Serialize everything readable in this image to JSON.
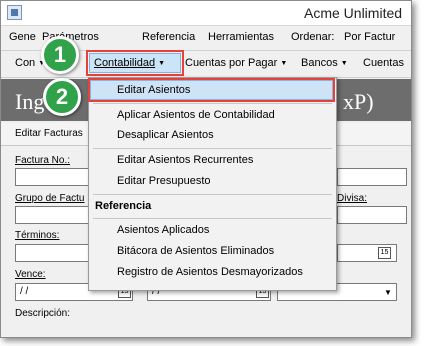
{
  "window": {
    "title": "Acme Unlimited"
  },
  "menubar": {
    "items": [
      "Gene",
      "Parámetros",
      "Referencia",
      "Herramientas",
      "Ordenar:",
      "Por Factur"
    ]
  },
  "toolbar": {
    "items": [
      "Con",
      "Contabilidad",
      "Cuentas por Pagar",
      "Bancos",
      "Cuentas"
    ]
  },
  "header": {
    "title": "Ing",
    "suffix": "xP)"
  },
  "subtab": {
    "label": "Editar Facturas"
  },
  "form": {
    "factura_label": "Factura No.:",
    "grupo_label": "Grupo de Factu",
    "divisa_label": "Divisa:",
    "terminos_label": "Términos:",
    "vence_label": "Vence:",
    "date1": "/ /",
    "date2": "/ /",
    "descripcion_label": "Descripción:"
  },
  "dropdown": {
    "items": [
      "Editar Asientos",
      "Aplicar Asientos de Contabilidad",
      "Desaplicar Asientos",
      "Editar Asientos Recurrentes",
      "Editar Presupuesto"
    ],
    "section_header": "Referencia",
    "reference_items": [
      "Asientos Aplicados",
      "Bitácora de Asientos Eliminados",
      "Registro de Asientos Desmayorizados"
    ]
  },
  "callouts": {
    "step1": "1",
    "step2": "2"
  },
  "colors": {
    "callout_green": "#2fa24a",
    "highlight_red": "#e8413a",
    "header_gray": "#6d6d6d"
  }
}
